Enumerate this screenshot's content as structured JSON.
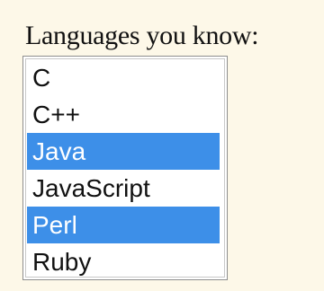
{
  "form": {
    "label": "Languages you know:"
  },
  "listbox": {
    "options": [
      {
        "label": "C",
        "selected": false
      },
      {
        "label": "C++",
        "selected": false
      },
      {
        "label": "Java",
        "selected": true
      },
      {
        "label": "JavaScript",
        "selected": false
      },
      {
        "label": "Perl",
        "selected": true
      },
      {
        "label": "Ruby",
        "selected": false
      }
    ]
  },
  "colors": {
    "background": "#fdf8e8",
    "selection": "#3d8fe8",
    "selected_text": "#ffffff",
    "text": "#111111"
  }
}
